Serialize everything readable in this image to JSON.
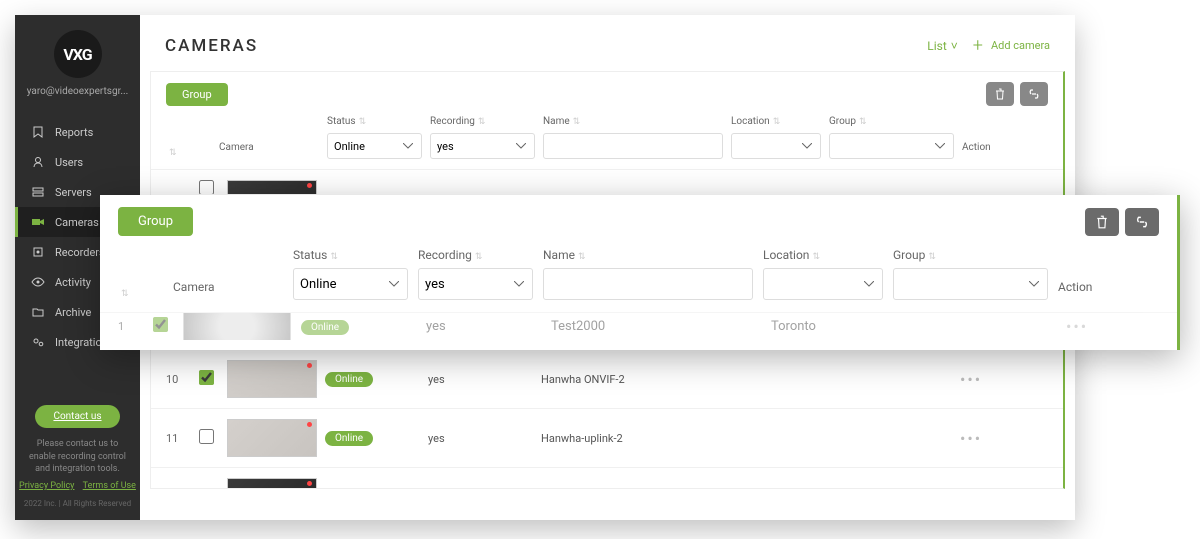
{
  "brand_logo_text": "VXG",
  "user_email": "yaro@videoexpertsgr...",
  "sidebar": {
    "items": [
      {
        "icon": "bookmark",
        "label": "Reports"
      },
      {
        "icon": "user",
        "label": "Users"
      },
      {
        "icon": "server",
        "label": "Servers"
      },
      {
        "icon": "video",
        "label": "Cameras"
      },
      {
        "icon": "record",
        "label": "Recorders"
      },
      {
        "icon": "eye",
        "label": "Activity"
      },
      {
        "icon": "folder",
        "label": "Archive"
      },
      {
        "icon": "gears",
        "label": "Integrations"
      }
    ],
    "active_index": 3,
    "contact_label": "Contact us",
    "footer_note": "Please contact us to enable recording control and integration tools.",
    "privacy": "Privacy Policy",
    "terms": "Terms of Use",
    "copyright": "2022 Inc. | All Rights Reserved"
  },
  "page": {
    "title": "CAMERAS",
    "view_label": "List",
    "add_label": "Add camera"
  },
  "table": {
    "group_btn": "Group",
    "columns": {
      "camera": "Camera",
      "status": "Status",
      "recording": "Recording",
      "name": "Name",
      "location": "Location",
      "group": "Group",
      "action": "Action"
    },
    "filters": {
      "status_value": "Online",
      "recording_value": "yes",
      "name_value": "",
      "location_value": "",
      "group_value": ""
    },
    "rows": [
      {
        "idx": "1",
        "checked": true,
        "thumb": "pattern",
        "status": "Online",
        "recording": "yes",
        "name": "Test2000",
        "location": "Toronto",
        "group": ""
      },
      {
        "idx": "10",
        "checked": true,
        "thumb": "room",
        "status": "Online",
        "recording": "yes",
        "name": "Hanwha ONVIF-2",
        "location": "",
        "group": ""
      },
      {
        "idx": "11",
        "checked": false,
        "thumb": "room",
        "status": "Online",
        "recording": "yes",
        "name": "Hanwha-uplink-2",
        "location": "",
        "group": ""
      }
    ]
  },
  "overlay": {
    "group_btn": "Group",
    "columns": {
      "camera": "Camera",
      "status": "Status",
      "recording": "Recording",
      "name": "Name",
      "location": "Location",
      "group": "Group",
      "action": "Action"
    },
    "filters": {
      "status_value": "Online",
      "recording_value": "yes",
      "name_value": "",
      "location_value": "",
      "group_value": ""
    },
    "row": {
      "idx": "1",
      "checked": true,
      "status": "Online",
      "recording": "yes",
      "name": "Test2000",
      "location": "Toronto",
      "group": ""
    }
  },
  "icons": {
    "bookmark": "🔖",
    "user": "👤",
    "server": "☰",
    "video": "■",
    "record": "▯",
    "eye": "👁",
    "folder": "📁",
    "gears": "⚙"
  }
}
